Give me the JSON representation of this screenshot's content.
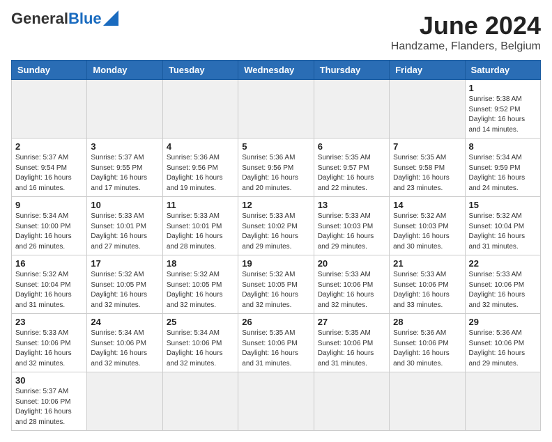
{
  "header": {
    "logo_general": "General",
    "logo_blue": "Blue",
    "title": "June 2024",
    "subtitle": "Handzame, Flanders, Belgium"
  },
  "days_of_week": [
    "Sunday",
    "Monday",
    "Tuesday",
    "Wednesday",
    "Thursday",
    "Friday",
    "Saturday"
  ],
  "weeks": [
    [
      {
        "num": "",
        "info": ""
      },
      {
        "num": "",
        "info": ""
      },
      {
        "num": "",
        "info": ""
      },
      {
        "num": "",
        "info": ""
      },
      {
        "num": "",
        "info": ""
      },
      {
        "num": "",
        "info": ""
      },
      {
        "num": "1",
        "info": "Sunrise: 5:38 AM\nSunset: 9:52 PM\nDaylight: 16 hours and 14 minutes."
      }
    ],
    [
      {
        "num": "2",
        "info": "Sunrise: 5:37 AM\nSunset: 9:54 PM\nDaylight: 16 hours and 16 minutes."
      },
      {
        "num": "3",
        "info": "Sunrise: 5:37 AM\nSunset: 9:55 PM\nDaylight: 16 hours and 17 minutes."
      },
      {
        "num": "4",
        "info": "Sunrise: 5:36 AM\nSunset: 9:56 PM\nDaylight: 16 hours and 19 minutes."
      },
      {
        "num": "5",
        "info": "Sunrise: 5:36 AM\nSunset: 9:56 PM\nDaylight: 16 hours and 20 minutes."
      },
      {
        "num": "6",
        "info": "Sunrise: 5:35 AM\nSunset: 9:57 PM\nDaylight: 16 hours and 22 minutes."
      },
      {
        "num": "7",
        "info": "Sunrise: 5:35 AM\nSunset: 9:58 PM\nDaylight: 16 hours and 23 minutes."
      },
      {
        "num": "8",
        "info": "Sunrise: 5:34 AM\nSunset: 9:59 PM\nDaylight: 16 hours and 24 minutes."
      }
    ],
    [
      {
        "num": "9",
        "info": "Sunrise: 5:34 AM\nSunset: 10:00 PM\nDaylight: 16 hours and 26 minutes."
      },
      {
        "num": "10",
        "info": "Sunrise: 5:33 AM\nSunset: 10:01 PM\nDaylight: 16 hours and 27 minutes."
      },
      {
        "num": "11",
        "info": "Sunrise: 5:33 AM\nSunset: 10:01 PM\nDaylight: 16 hours and 28 minutes."
      },
      {
        "num": "12",
        "info": "Sunrise: 5:33 AM\nSunset: 10:02 PM\nDaylight: 16 hours and 29 minutes."
      },
      {
        "num": "13",
        "info": "Sunrise: 5:33 AM\nSunset: 10:03 PM\nDaylight: 16 hours and 29 minutes."
      },
      {
        "num": "14",
        "info": "Sunrise: 5:32 AM\nSunset: 10:03 PM\nDaylight: 16 hours and 30 minutes."
      },
      {
        "num": "15",
        "info": "Sunrise: 5:32 AM\nSunset: 10:04 PM\nDaylight: 16 hours and 31 minutes."
      }
    ],
    [
      {
        "num": "16",
        "info": "Sunrise: 5:32 AM\nSunset: 10:04 PM\nDaylight: 16 hours and 31 minutes."
      },
      {
        "num": "17",
        "info": "Sunrise: 5:32 AM\nSunset: 10:05 PM\nDaylight: 16 hours and 32 minutes."
      },
      {
        "num": "18",
        "info": "Sunrise: 5:32 AM\nSunset: 10:05 PM\nDaylight: 16 hours and 32 minutes."
      },
      {
        "num": "19",
        "info": "Sunrise: 5:32 AM\nSunset: 10:05 PM\nDaylight: 16 hours and 32 minutes."
      },
      {
        "num": "20",
        "info": "Sunrise: 5:33 AM\nSunset: 10:06 PM\nDaylight: 16 hours and 32 minutes."
      },
      {
        "num": "21",
        "info": "Sunrise: 5:33 AM\nSunset: 10:06 PM\nDaylight: 16 hours and 33 minutes."
      },
      {
        "num": "22",
        "info": "Sunrise: 5:33 AM\nSunset: 10:06 PM\nDaylight: 16 hours and 32 minutes."
      }
    ],
    [
      {
        "num": "23",
        "info": "Sunrise: 5:33 AM\nSunset: 10:06 PM\nDaylight: 16 hours and 32 minutes."
      },
      {
        "num": "24",
        "info": "Sunrise: 5:34 AM\nSunset: 10:06 PM\nDaylight: 16 hours and 32 minutes."
      },
      {
        "num": "25",
        "info": "Sunrise: 5:34 AM\nSunset: 10:06 PM\nDaylight: 16 hours and 32 minutes."
      },
      {
        "num": "26",
        "info": "Sunrise: 5:35 AM\nSunset: 10:06 PM\nDaylight: 16 hours and 31 minutes."
      },
      {
        "num": "27",
        "info": "Sunrise: 5:35 AM\nSunset: 10:06 PM\nDaylight: 16 hours and 31 minutes."
      },
      {
        "num": "28",
        "info": "Sunrise: 5:36 AM\nSunset: 10:06 PM\nDaylight: 16 hours and 30 minutes."
      },
      {
        "num": "29",
        "info": "Sunrise: 5:36 AM\nSunset: 10:06 PM\nDaylight: 16 hours and 29 minutes."
      }
    ],
    [
      {
        "num": "30",
        "info": "Sunrise: 5:37 AM\nSunset: 10:06 PM\nDaylight: 16 hours and 28 minutes."
      },
      {
        "num": "",
        "info": ""
      },
      {
        "num": "",
        "info": ""
      },
      {
        "num": "",
        "info": ""
      },
      {
        "num": "",
        "info": ""
      },
      {
        "num": "",
        "info": ""
      },
      {
        "num": "",
        "info": ""
      }
    ]
  ]
}
